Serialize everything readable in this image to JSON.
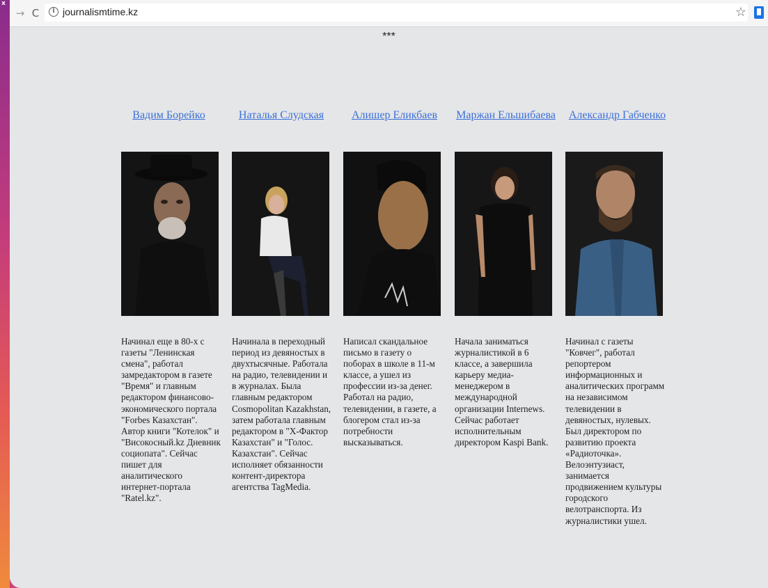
{
  "browser": {
    "url": "journalismtime.kz",
    "nav": {
      "forward_icon": "arrow-right-icon",
      "reload_icon": "reload-icon"
    }
  },
  "page": {
    "separator": "***",
    "people": [
      {
        "name": "Вадим Борейко",
        "bio": "Начинал еще в 80-х с газеты \"Ленинская смена\", работал замредактором в газете \"Время\" и главным редактором финансово-экономического портала \"Forbes Казахстан\". Автор книги \"Котелок\" и \"Високосный.kz Дневник социопата\". Сейчас пишет для аналитического интернет-портала \"Ratel.kz\"."
      },
      {
        "name": "Наталья Слудская",
        "bio": "Начинала в переходный период из девяностых в двухтысячные. Работала на радио, телевидении и в журналах. Была главным редактором Cosmopolitan Kazakhstan, затем работала главным редактором в \"Х-Фактор Казахстан\" и \"Голос. Казахстан\". Сейчас исполняет обязанности контент-директора агентства TagMedia."
      },
      {
        "name": "Алишер Еликбаев",
        "bio": "Написал скандальное письмо в газету о поборах в школе в 11-м классе, а ушел из профессии из-за денег. Работал на радио, телевидении, в газете, а блогером стал из-за потребности высказываться."
      },
      {
        "name": "Маржан Ельшибаева",
        "bio": "Начала заниматься журналистикой в 6 классе, а завершила карьеру медиа-менеджером в международной организации Internews. Сейчас работает исполнительным директором Kaspi Bank."
      },
      {
        "name": "Александр Габченко",
        "bio": "Начинал с газеты \"Ковчег\", работал репортером информационных и аналитических программ на независимом телевидении в девяностых, нулевых. Был директором по развитию проекта «Радиоточка». Велоэнтузиаст, занимается продвижением культуры городского велотранспорта. Из журналистики ушел."
      }
    ]
  }
}
